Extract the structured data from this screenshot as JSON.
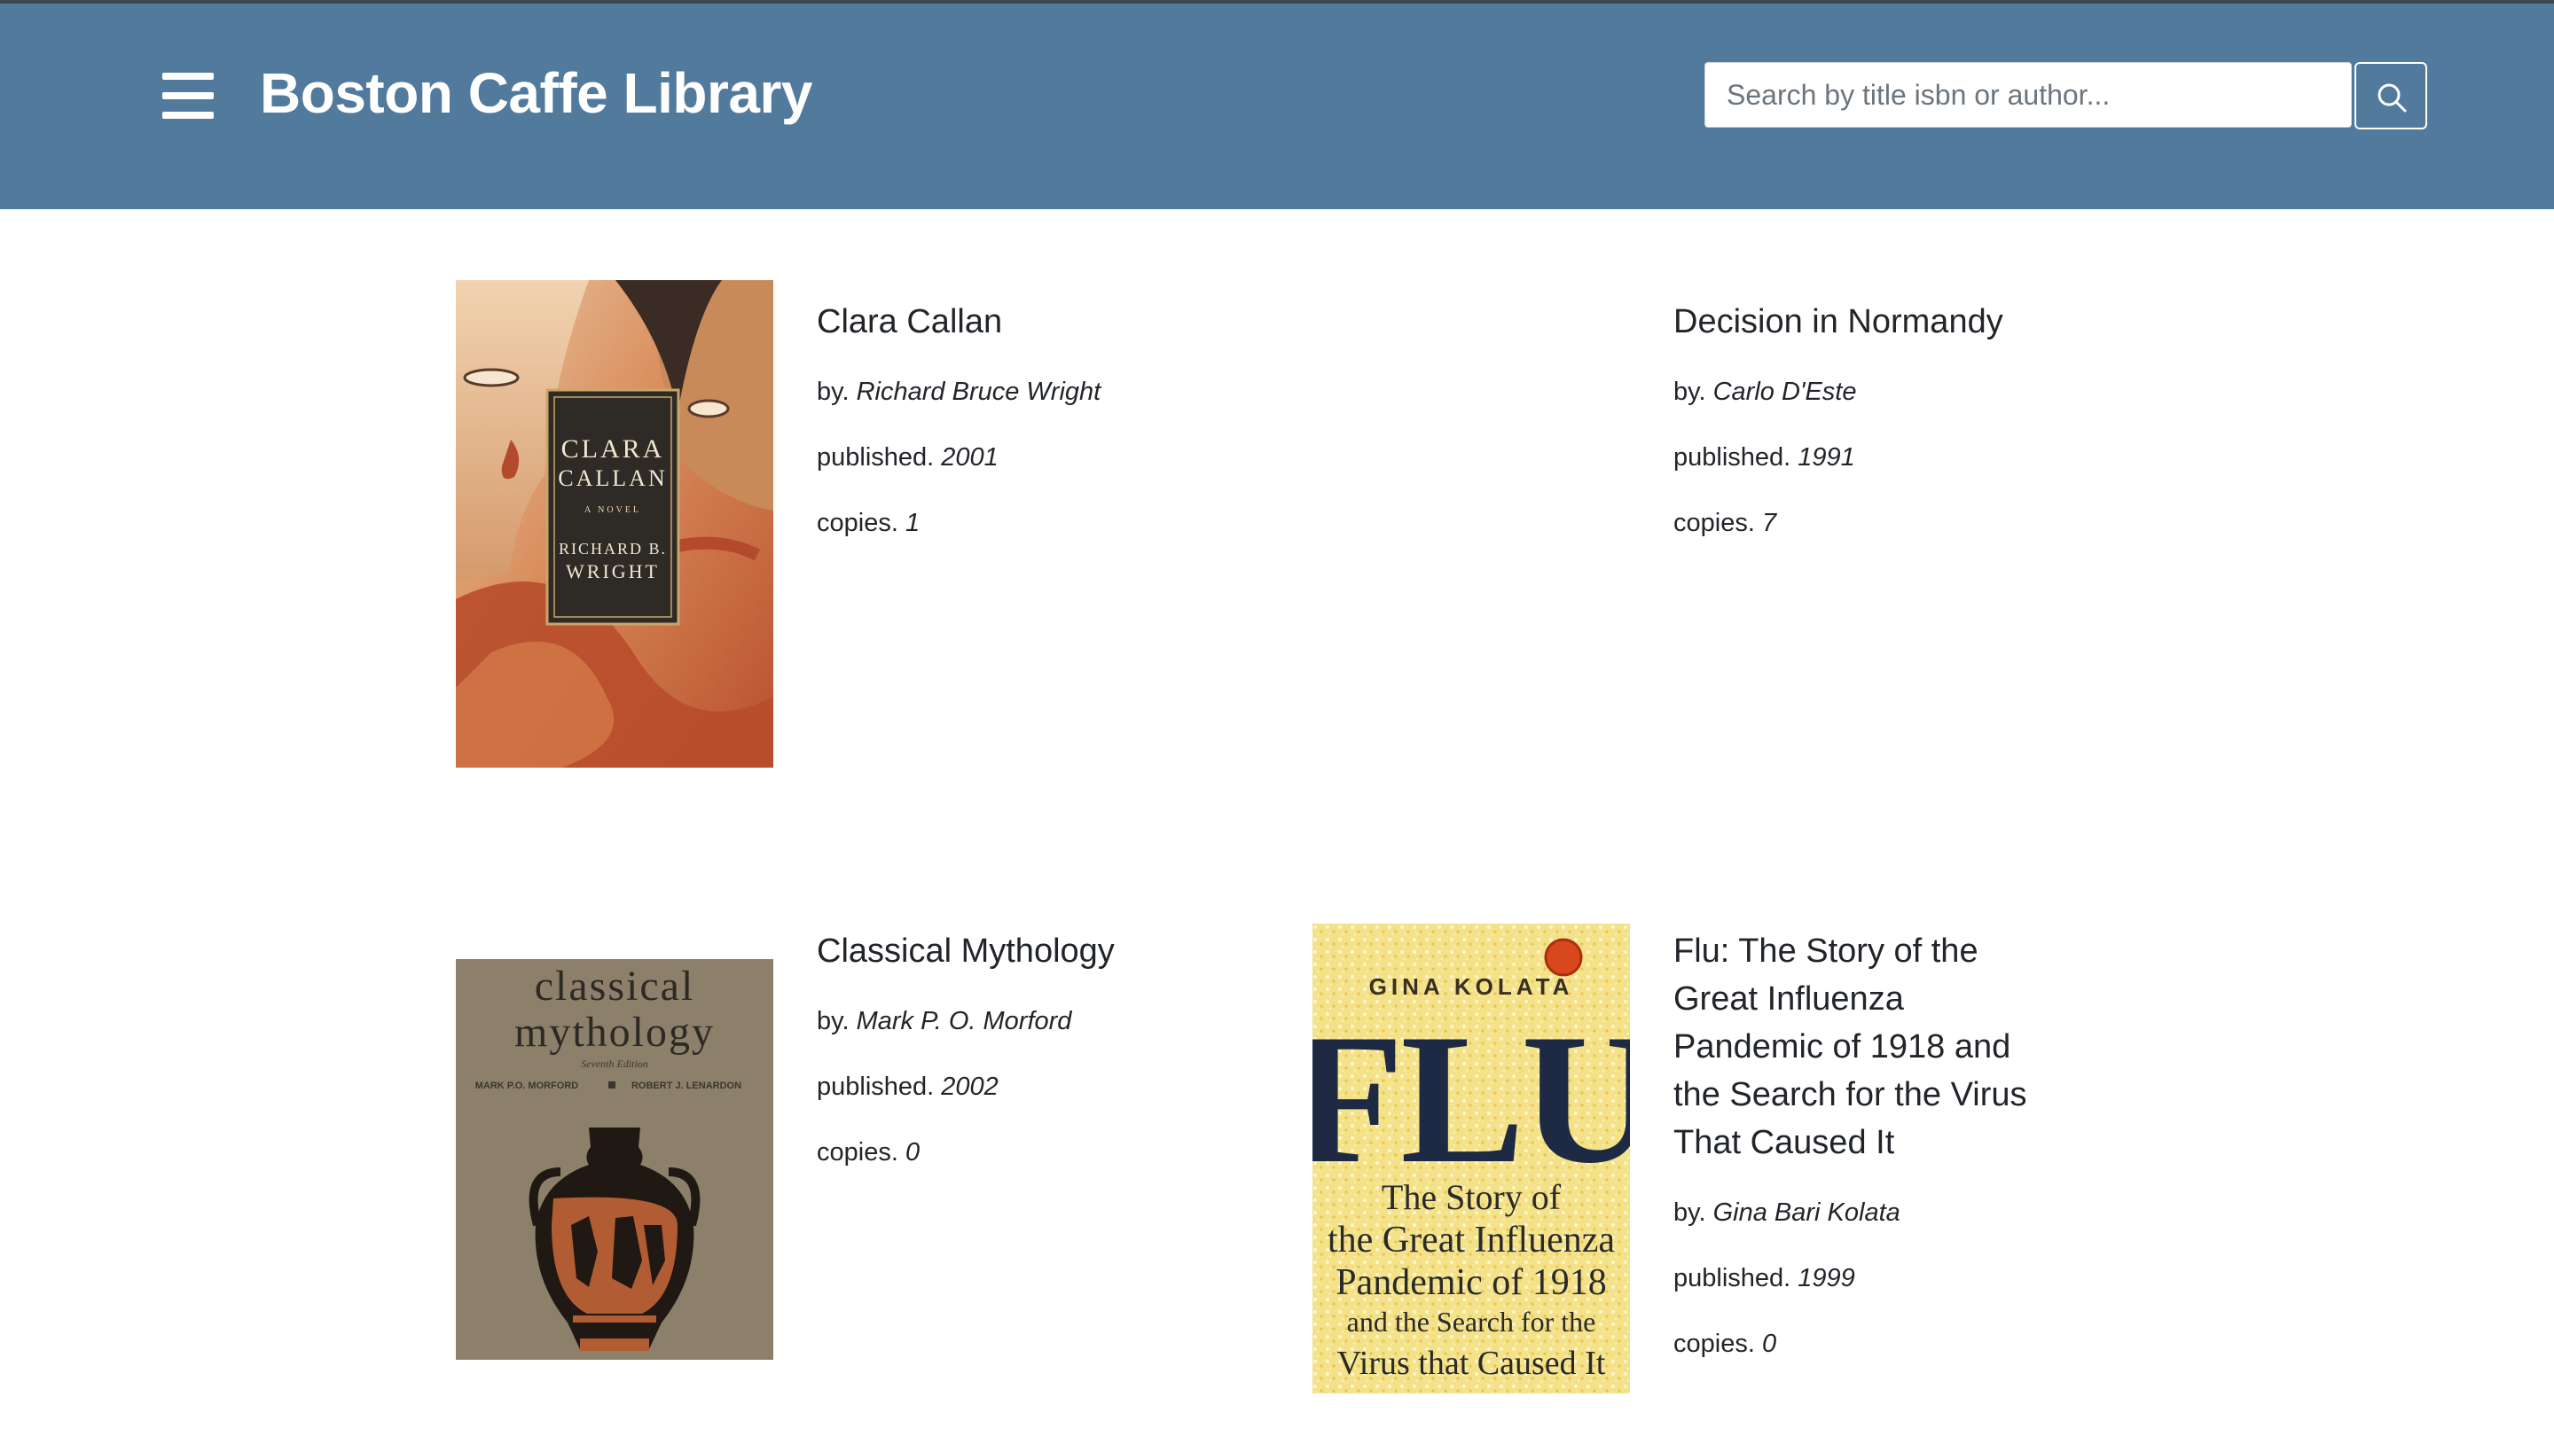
{
  "app": {
    "brand": "Boston Caffe Library",
    "search_placeholder": "Search by title isbn or author..."
  },
  "labels": {
    "by": "by.",
    "published": "published.",
    "copies": "copies."
  },
  "books": [
    {
      "title": "Clara Callan",
      "author": "Richard Bruce Wright",
      "published": "2001",
      "copies": "1",
      "cover": {
        "lines": [
          "CLARA",
          "CALLAN",
          "A NOVEL",
          "RICHARD B.",
          "WRIGHT"
        ]
      }
    },
    {
      "title": "Decision in Normandy",
      "author": "Carlo D'Este",
      "published": "1991",
      "copies": "7"
    },
    {
      "title": "Classical Mythology",
      "author": "Mark P. O. Morford",
      "published": "2002",
      "copies": "0",
      "cover": {
        "lines": [
          "classical",
          "mythology",
          "Seventh Edition",
          "MARK P.O. MORFORD",
          "ROBERT J. LENARDON"
        ]
      }
    },
    {
      "title": "Flu: The Story of the Great Influenza Pandemic of 1918 and the Search for the Virus That Caused It",
      "title_lines": [
        "Flu: The Story of the",
        "Great Influenza",
        "Pandemic of 1918 and",
        "the Search for the Virus",
        "That Caused It"
      ],
      "author": "Gina Bari Kolata",
      "published": "1999",
      "copies": "0",
      "cover": {
        "lines": [
          "GINA KOLATA",
          "FLU",
          "The Story of",
          "the Great Influenza",
          "Pandemic of 1918",
          "and the Search for the",
          "Virus that Caused It"
        ]
      }
    }
  ],
  "colors": {
    "navbar": "#527a9c",
    "text": "#212529"
  }
}
